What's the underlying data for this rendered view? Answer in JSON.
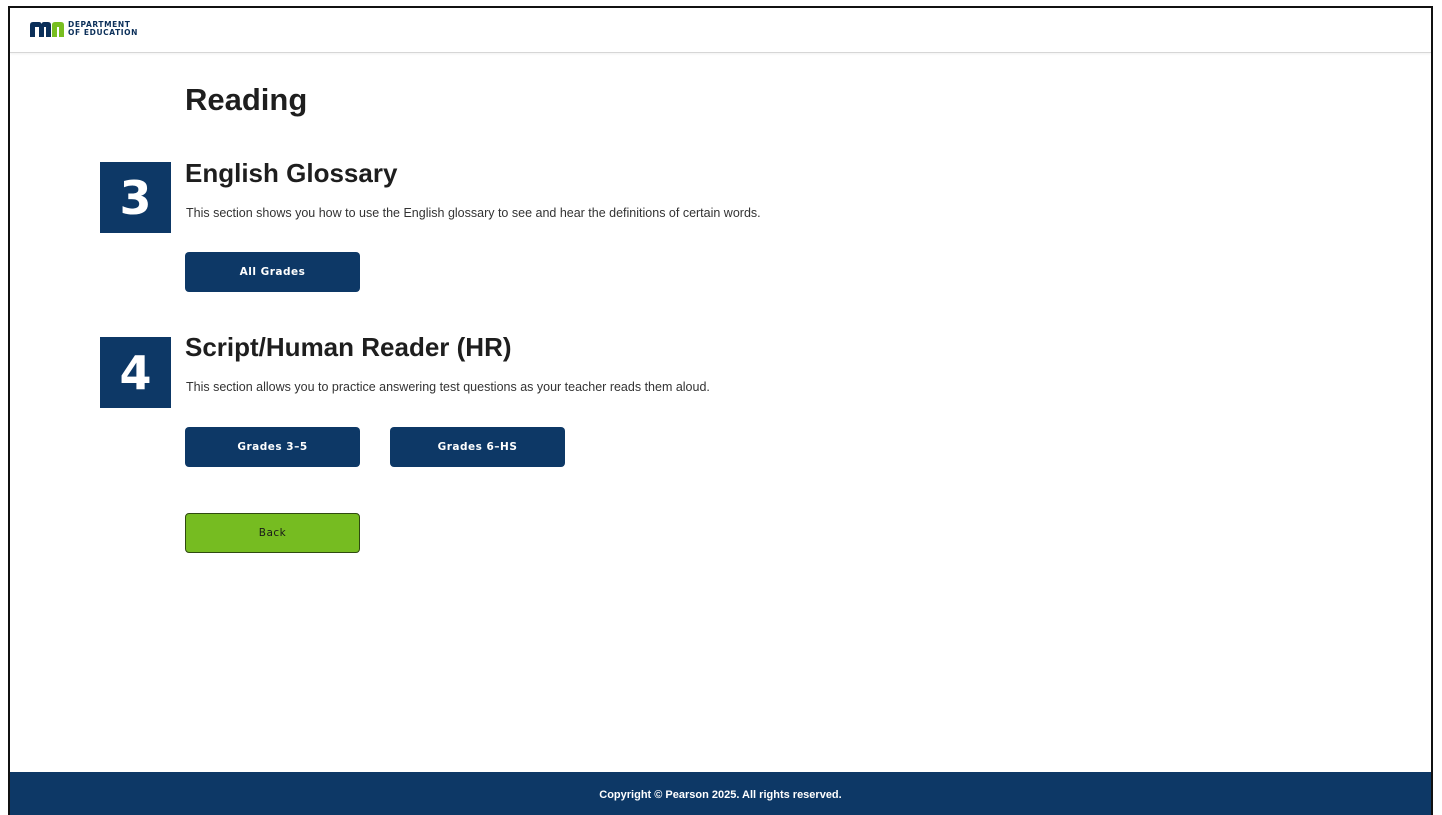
{
  "header": {
    "logo_icon": "mn-logo-icon",
    "logo_line1": "DEPARTMENT",
    "logo_line2": "OF EDUCATION"
  },
  "main": {
    "title": "Reading",
    "sections": [
      {
        "number": "3",
        "title": "English Glossary",
        "description": "This section shows you how to use the English glossary to see and hear the definitions of certain words.",
        "buttons": [
          "All Grades"
        ]
      },
      {
        "number": "4",
        "title": "Script/Human Reader (HR)",
        "description": "This section allows you to practice answering test questions as your teacher reads them aloud.",
        "buttons": [
          "Grades 3–5",
          "Grades 6–HS"
        ]
      }
    ],
    "back_label": "Back"
  },
  "footer": {
    "copyright": "Copyright © Pearson 2025. All rights reserved."
  },
  "colors": {
    "brand_navy": "#0d3866",
    "back_green": "#76bc21",
    "logo_green": "#78be20"
  }
}
